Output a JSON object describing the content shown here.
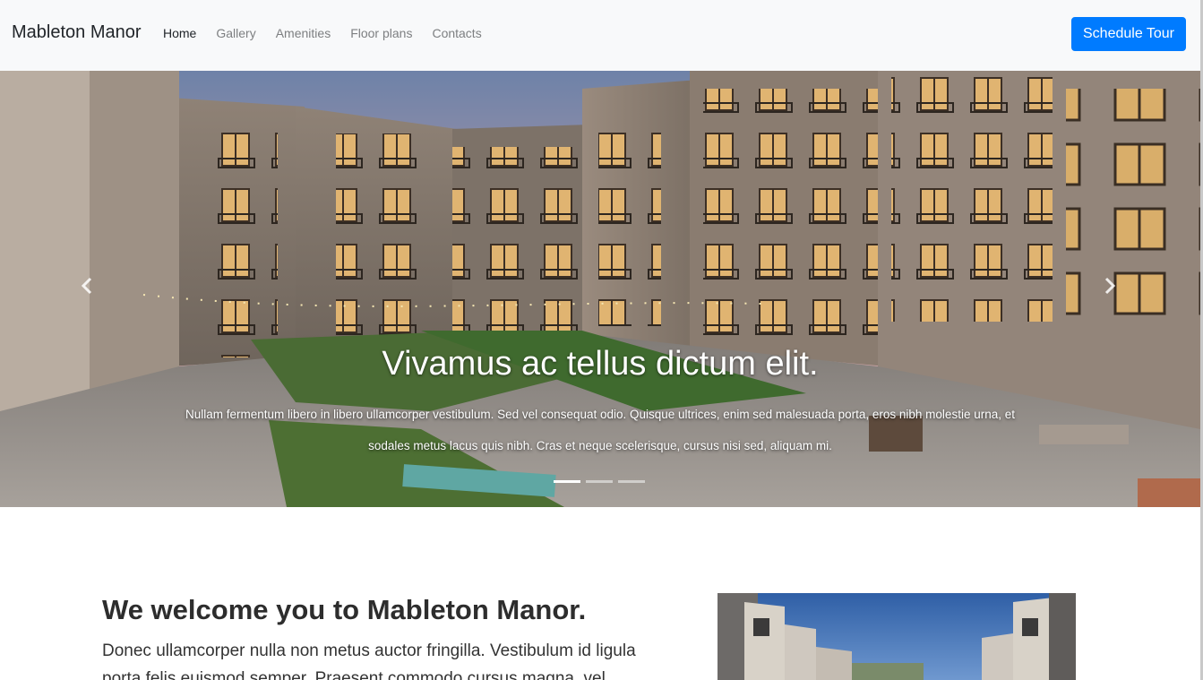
{
  "navbar": {
    "brand": "Mableton Manor",
    "links": [
      {
        "label": "Home",
        "active": true
      },
      {
        "label": "Gallery",
        "active": false
      },
      {
        "label": "Amenities",
        "active": false
      },
      {
        "label": "Floor plans",
        "active": false
      },
      {
        "label": "Contacts",
        "active": false
      }
    ],
    "cta_label": "Schedule Tour"
  },
  "carousel": {
    "title": "Vivamus ac tellus dictum elit.",
    "text": "Nullam fermentum libero in libero ullamcorper vestibulum. Sed vel consequat odio. Quisque ultrices, enim sed malesuada porta, eros nibh molestie urna, et sodales metus lacus quis nibh. Cras et neque scelerisque, cursus nisi sed, aliquam mi.",
    "slide_count": 3,
    "active_slide": 1
  },
  "welcome": {
    "title": "We welcome you to Mableton Manor.",
    "text": "Donec ullamcorper nulla non metus auctor fringilla. Vestibulum id ligula porta felis euismod semper. Praesent commodo cursus magna, vel"
  },
  "colors": {
    "navbar_bg": "#f8f9fa",
    "primary": "#007bff",
    "text": "#212529",
    "muted": "#7d7f81"
  }
}
